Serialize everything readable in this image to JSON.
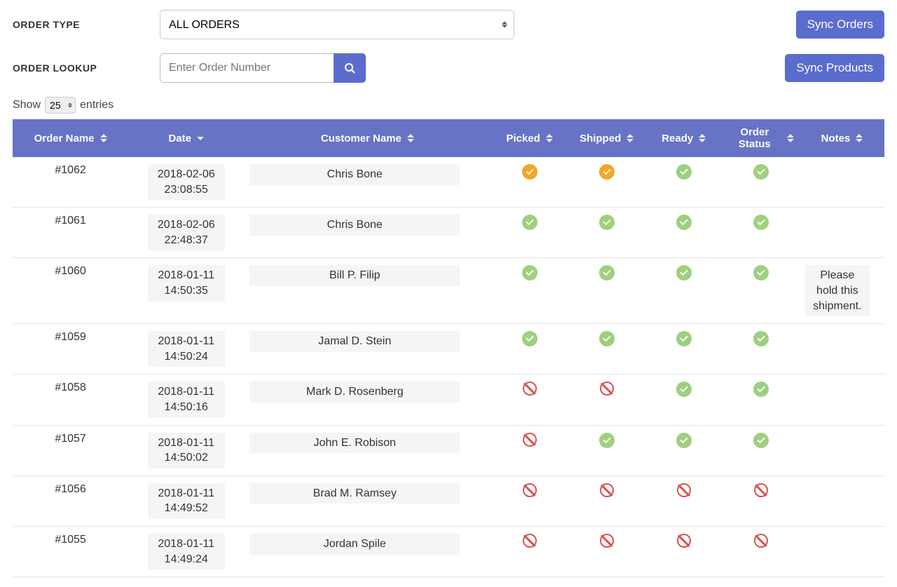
{
  "labels": {
    "orderType": "ORDER TYPE",
    "orderLookup": "ORDER LOOKUP",
    "show": "Show",
    "entries": "entries"
  },
  "orderTypeSelect": {
    "value": "ALL ORDERS",
    "options": [
      "ALL ORDERS"
    ]
  },
  "orderLookup": {
    "placeholder": "Enter Order Number",
    "value": ""
  },
  "buttons": {
    "syncOrders": "Sync Orders",
    "syncProducts": "Sync Products"
  },
  "entriesSelect": {
    "value": "25",
    "options": [
      "25"
    ]
  },
  "columns": [
    {
      "label": "Order Name",
      "key": "orderName",
      "sort": "both",
      "cls": "col-order"
    },
    {
      "label": "Date",
      "key": "date",
      "sort": "desc",
      "cls": "col-date"
    },
    {
      "label": "Customer Name",
      "key": "customer",
      "sort": "both",
      "cls": "col-cust"
    },
    {
      "label": "Picked",
      "key": "picked",
      "sort": "both",
      "cls": "col-stat"
    },
    {
      "label": "Shipped",
      "key": "shipped",
      "sort": "both",
      "cls": "col-stat"
    },
    {
      "label": "Ready",
      "key": "ready",
      "sort": "both",
      "cls": "col-stat"
    },
    {
      "label": "Order Status",
      "key": "status",
      "sort": "both",
      "cls": "col-stat"
    },
    {
      "label": "Notes",
      "key": "notes",
      "sort": "both",
      "cls": "col-notes"
    }
  ],
  "rows": [
    {
      "orderName": "#1062",
      "date": "2018-02-06 23:08:55",
      "customer": "Chris Bone",
      "picked": "orange",
      "shipped": "orange",
      "ready": "green",
      "status": "green",
      "notes": ""
    },
    {
      "orderName": "#1061",
      "date": "2018-02-06 22:48:37",
      "customer": "Chris Bone",
      "picked": "green",
      "shipped": "green",
      "ready": "green",
      "status": "green",
      "notes": ""
    },
    {
      "orderName": "#1060",
      "date": "2018-01-11 14:50:35",
      "customer": "Bill P. Filip",
      "picked": "green",
      "shipped": "green",
      "ready": "green",
      "status": "green",
      "notes": "Please hold this shipment."
    },
    {
      "orderName": "#1059",
      "date": "2018-01-11 14:50:24",
      "customer": "Jamal D. Stein",
      "picked": "green",
      "shipped": "green",
      "ready": "green",
      "status": "green",
      "notes": ""
    },
    {
      "orderName": "#1058",
      "date": "2018-01-11 14:50:16",
      "customer": "Mark D. Rosenberg",
      "picked": "none",
      "shipped": "none",
      "ready": "green",
      "status": "green",
      "notes": ""
    },
    {
      "orderName": "#1057",
      "date": "2018-01-11 14:50:02",
      "customer": "John E. Robison",
      "picked": "none",
      "shipped": "green",
      "ready": "green",
      "status": "green",
      "notes": ""
    },
    {
      "orderName": "#1056",
      "date": "2018-01-11 14:49:52",
      "customer": "Brad M. Ramsey",
      "picked": "none",
      "shipped": "none",
      "ready": "none",
      "status": "none",
      "notes": ""
    },
    {
      "orderName": "#1055",
      "date": "2018-01-11 14:49:24",
      "customer": "Jordan Spile",
      "picked": "none",
      "shipped": "none",
      "ready": "none",
      "status": "none",
      "notes": ""
    }
  ],
  "icons": {
    "search": "search-icon",
    "sort": "sort-icon"
  },
  "colors": {
    "primary": "#5b6ccf",
    "headerBg": "#6773c5",
    "green": "#9ed07f",
    "orange": "#f5a623",
    "red": "#d9534f"
  }
}
